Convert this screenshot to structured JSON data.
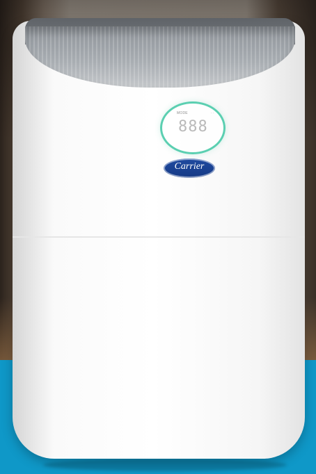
{
  "product": {
    "display_small": "MODE",
    "display_dots": "· ·",
    "display_main": "888",
    "logo_text": "Carrier"
  }
}
